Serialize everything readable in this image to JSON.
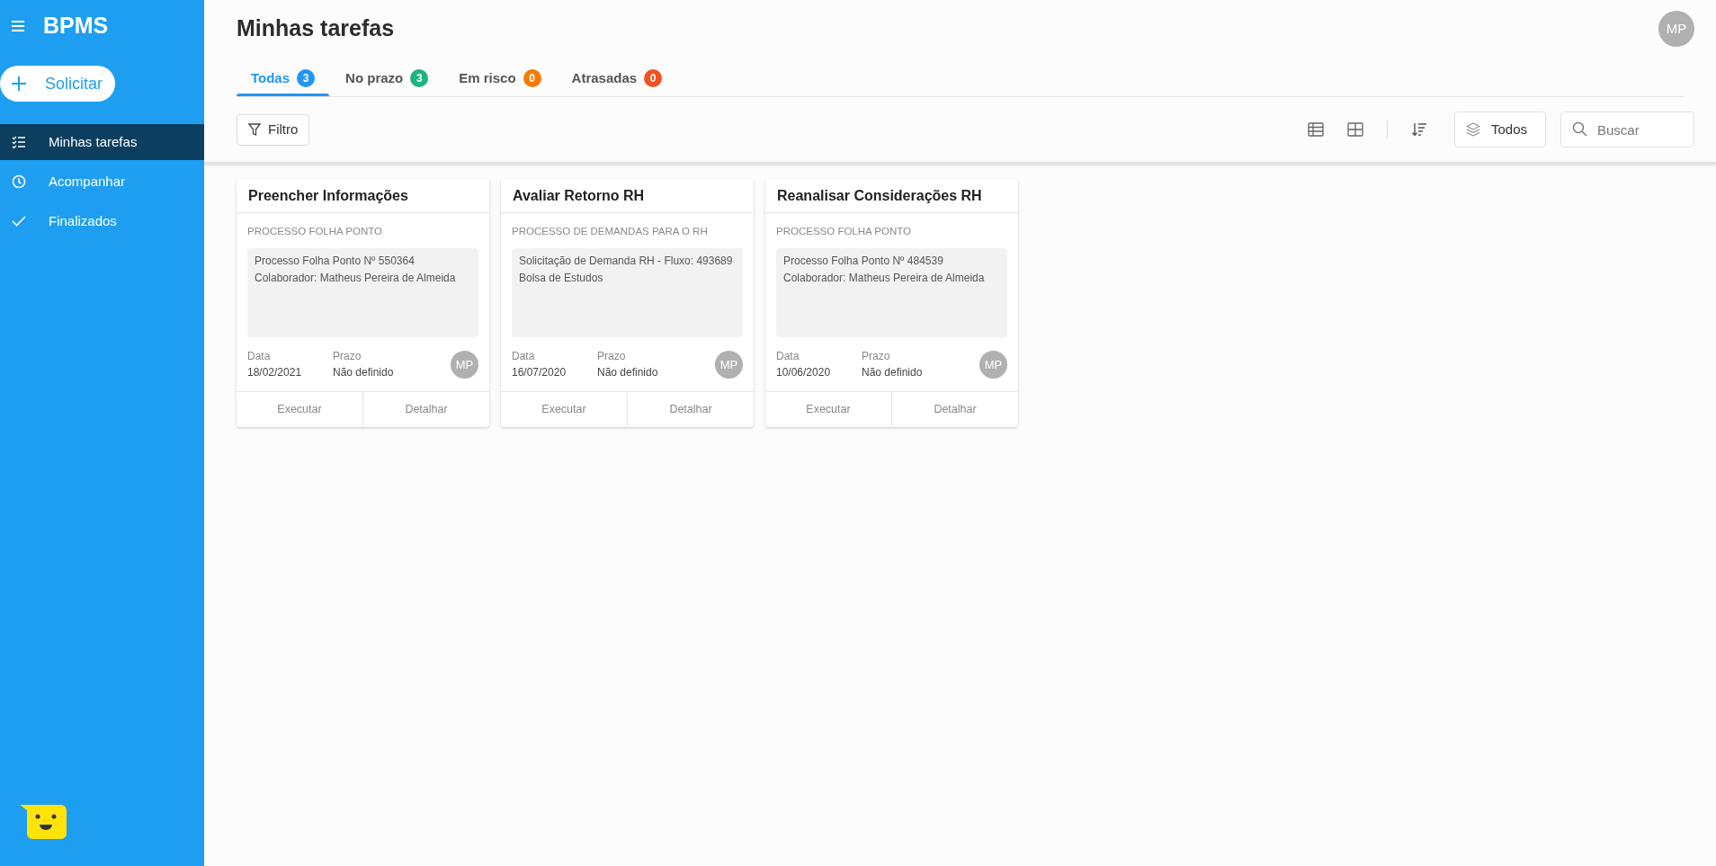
{
  "sidebar": {
    "brand": "BPMS",
    "action_button": "Solicitar",
    "items": [
      {
        "label": "Minhas tarefas",
        "selected": true
      },
      {
        "label": "Acompanhar",
        "selected": false
      },
      {
        "label": "Finalizados",
        "selected": false
      }
    ]
  },
  "header": {
    "title": "Minhas tarefas",
    "avatar": "MP"
  },
  "tabs": [
    {
      "label": "Todas",
      "count": "3",
      "color": "#2196f3",
      "selected": true
    },
    {
      "label": "No prazo",
      "count": "3",
      "color": "#1db47f",
      "selected": false
    },
    {
      "label": "Em risco",
      "count": "0",
      "color": "#f57c00",
      "selected": false
    },
    {
      "label": "Atrasadas",
      "count": "0",
      "color": "#f4511e",
      "selected": false
    }
  ],
  "toolbar": {
    "filter_button": "Filtro",
    "dropdown": "Todos",
    "search": {
      "placeholder": "Buscar"
    }
  },
  "cards": [
    {
      "title": "Preencher Informações",
      "process": "PROCESSO FOLHA PONTO",
      "description": [
        "Processo Folha Ponto Nº 550364",
        "Colaborador: Matheus Pereira de Almeida"
      ],
      "date_label": "Data",
      "date": "18/02/2021",
      "deadline_label": "Prazo",
      "deadline": "Não definido",
      "avatar": "MP",
      "actions": [
        "Executar",
        "Detalhar"
      ]
    },
    {
      "title": "Avaliar Retorno RH",
      "process": "PROCESSO DE DEMANDAS PARA O RH",
      "description": [
        "Solicitação de Demanda RH - Fluxo: 493689",
        "Bolsa de Estudos"
      ],
      "date_label": "Data",
      "date": "16/07/2020",
      "deadline_label": "Prazo",
      "deadline": "Não definido",
      "avatar": "MP",
      "actions": [
        "Executar",
        "Detalhar"
      ]
    },
    {
      "title": "Reanalisar Considerações RH",
      "process": "PROCESSO FOLHA PONTO",
      "description": [
        "Processo Folha Ponto Nº 484539",
        "Colaborador: Matheus Pereira de Almeida"
      ],
      "date_label": "Data",
      "date": "10/06/2020",
      "deadline_label": "Prazo",
      "deadline": "Não definido",
      "avatar": "MP",
      "actions": [
        "Executar",
        "Detalhar"
      ]
    }
  ]
}
